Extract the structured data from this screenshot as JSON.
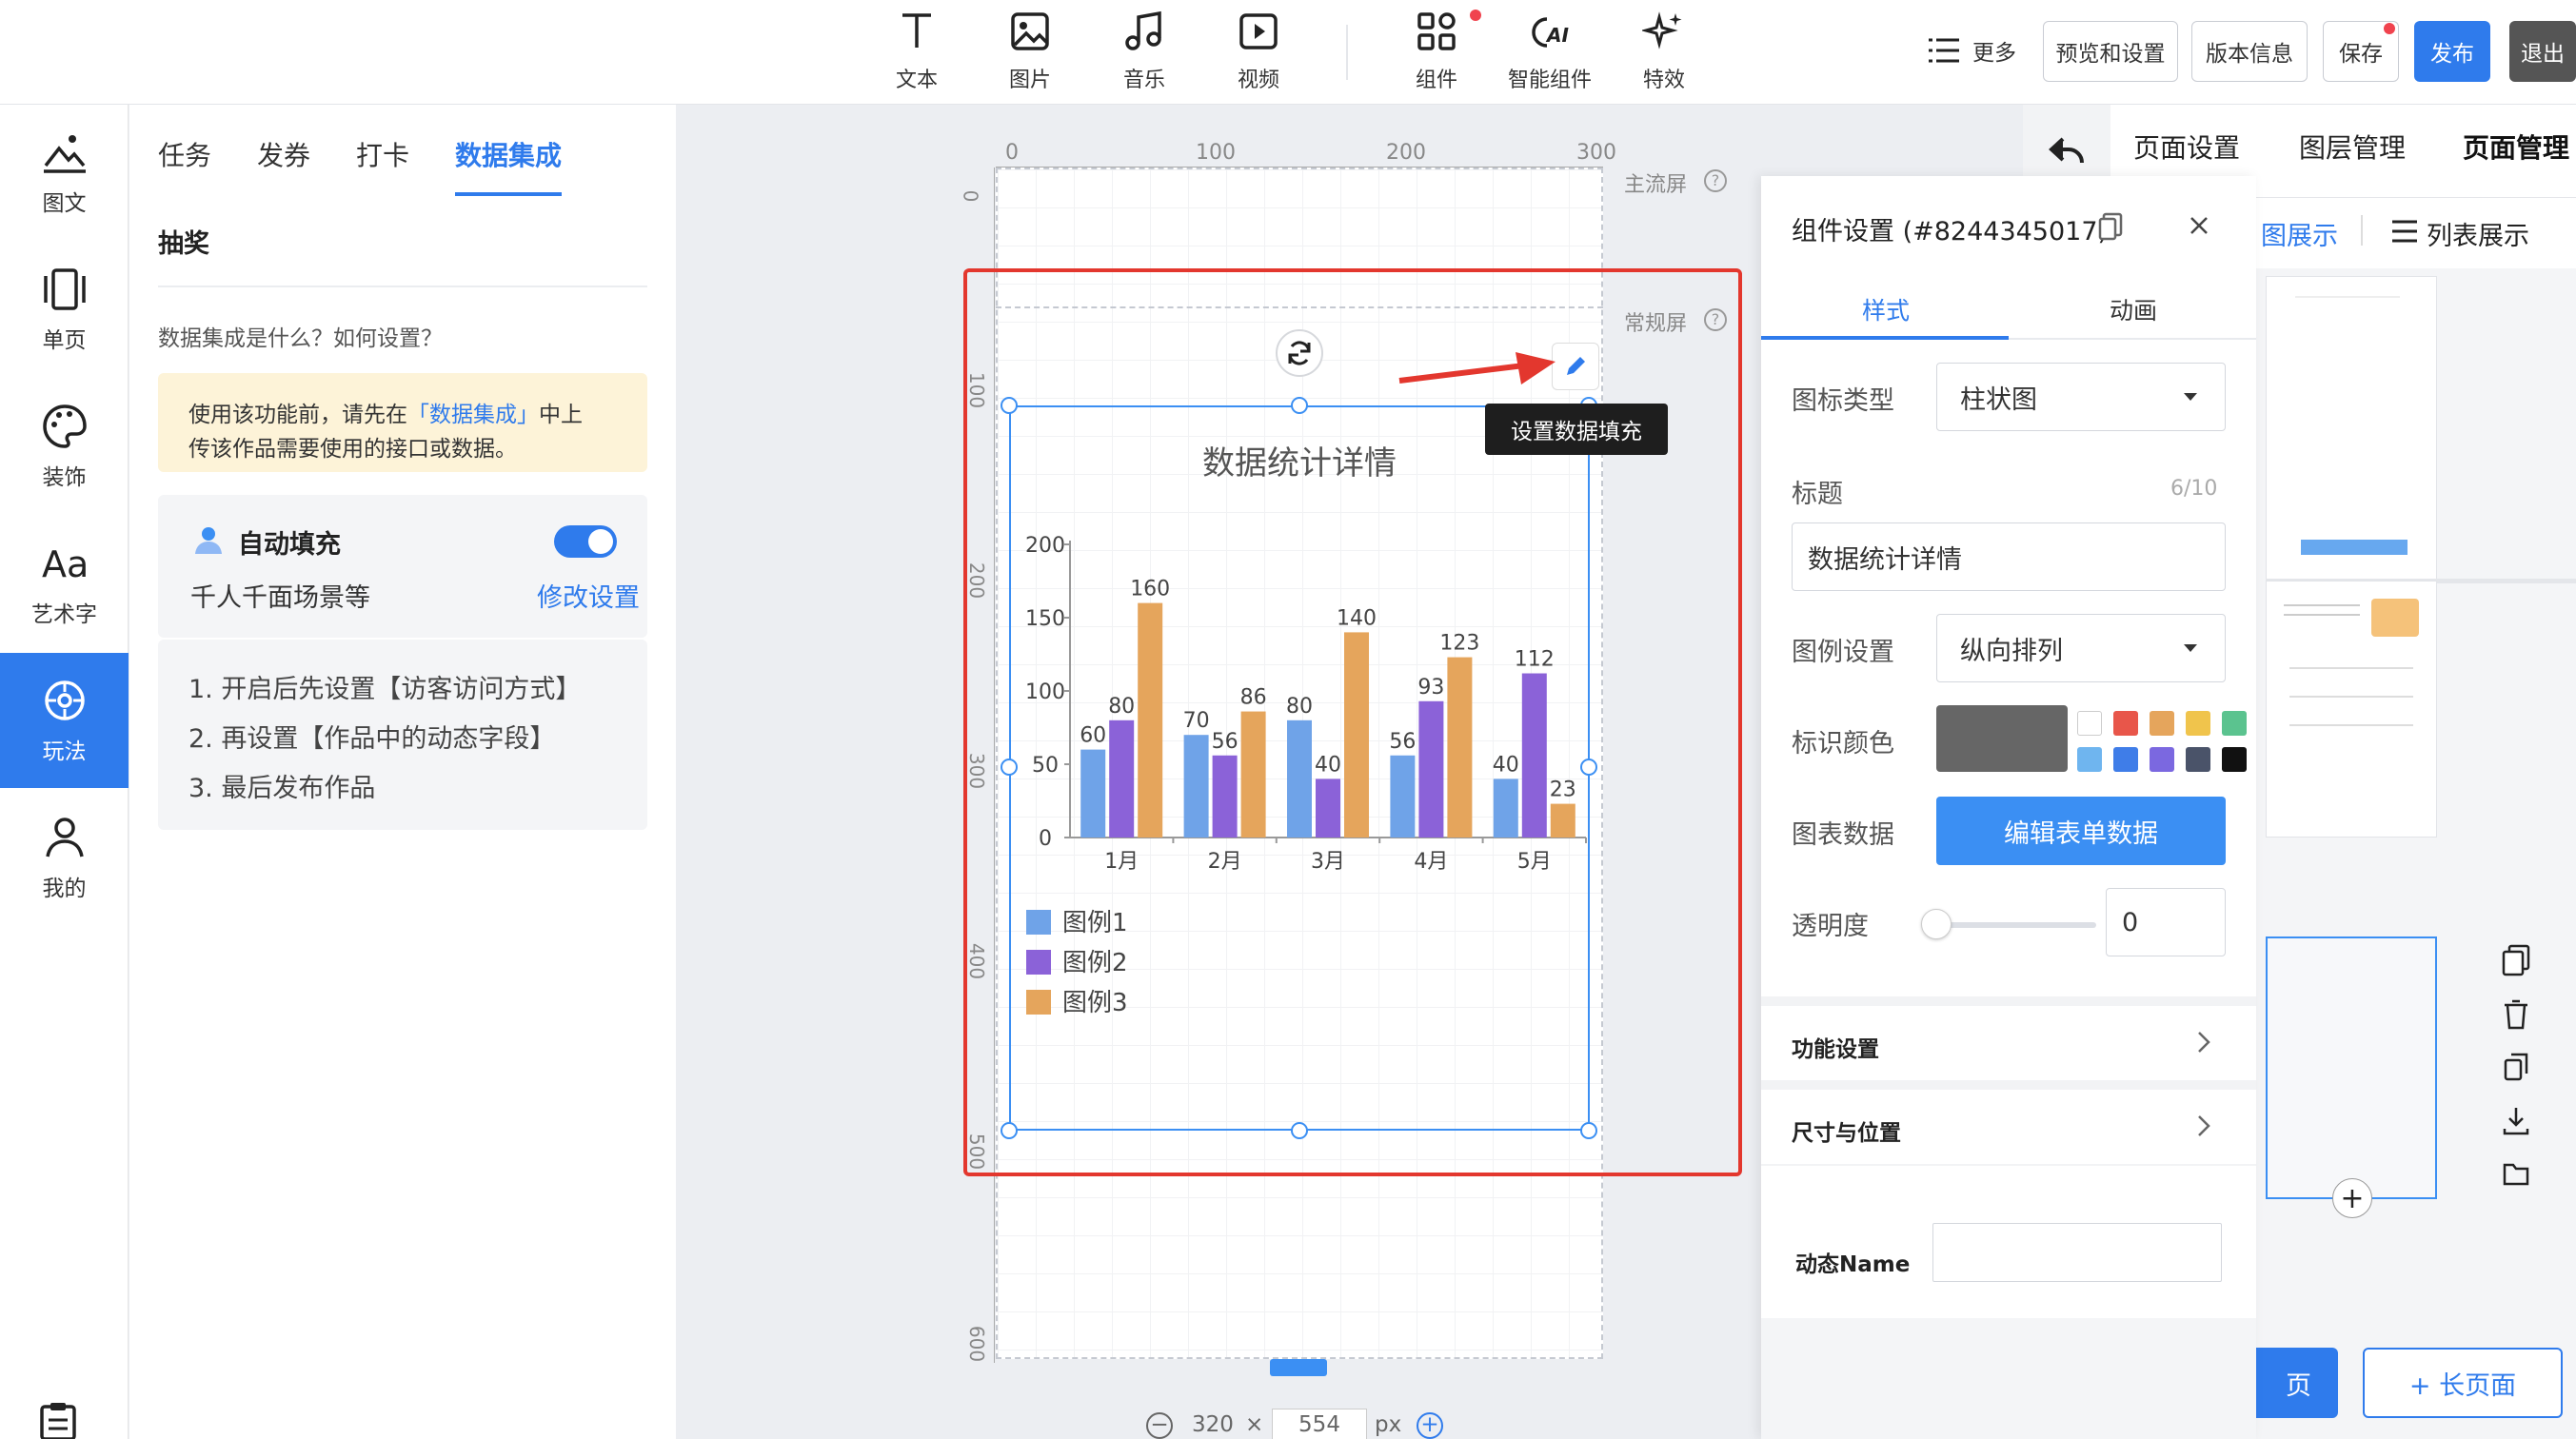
{
  "toolbar": {
    "tools": [
      {
        "label": "文本",
        "icon": "text-icon"
      },
      {
        "label": "图片",
        "icon": "image-icon"
      },
      {
        "label": "音乐",
        "icon": "music-icon"
      },
      {
        "label": "视频",
        "icon": "video-icon"
      },
      {
        "label": "组件",
        "icon": "components-icon"
      },
      {
        "label": "智能组件",
        "icon": "ai-components-icon"
      },
      {
        "label": "特效",
        "icon": "effects-icon"
      }
    ],
    "more": "更多",
    "preview": "预览和设置",
    "version": "版本信息",
    "save": "保存",
    "publish": "发布",
    "exit": "退出"
  },
  "leftnav": [
    {
      "label": "图文",
      "icon": "image-text-icon"
    },
    {
      "label": "单页",
      "icon": "single-page-icon"
    },
    {
      "label": "装饰",
      "icon": "palette-icon"
    },
    {
      "label": "艺术字",
      "icon": "art-text-icon"
    },
    {
      "label": "玩法",
      "icon": "gameplay-icon",
      "active": true
    },
    {
      "label": "我的",
      "icon": "user-icon"
    }
  ],
  "panel": {
    "tabs": [
      "任务",
      "发券",
      "打卡",
      "数据集成"
    ],
    "active_tab": "数据集成",
    "sub_item": "抽奖",
    "help": "数据集成是什么？如何设置？",
    "notice_a": "使用该功能前，请先在",
    "notice_link": "「数据集成」",
    "notice_b": "中上",
    "notice_c": "传该作品需要使用的接口或数据。",
    "auto_fill_title": "自动填充",
    "auto_fill_desc": "千人千面场景等",
    "modify": "修改设置",
    "steps": [
      "1. 开启后先设置【访客访问方式】",
      "2. 再设置【作品中的动态字段】",
      "3. 最后发布作品"
    ]
  },
  "canvas": {
    "ruler_top": [
      "0",
      "100",
      "200",
      "300"
    ],
    "ruler_left": [
      "0",
      "100",
      "200",
      "300",
      "400",
      "500",
      "600"
    ],
    "main_screen": "主流屏",
    "normal_screen": "常规屏",
    "tooltip": "设置数据填充",
    "width": "320",
    "height": "554",
    "unit": "px",
    "times": "×"
  },
  "chart_data": {
    "type": "bar",
    "title": "数据统计详情",
    "categories": [
      "1月",
      "2月",
      "3月",
      "4月",
      "5月"
    ],
    "series": [
      {
        "name": "图例1",
        "values": [
          60,
          70,
          80,
          56,
          40
        ],
        "color": "#6fa3e8"
      },
      {
        "name": "图例2",
        "values": [
          80,
          56,
          40,
          93,
          112
        ],
        "color": "#8b62d8"
      },
      {
        "name": "图例3",
        "values": [
          160,
          86,
          140,
          123,
          23
        ],
        "color": "#e5a55c"
      }
    ],
    "yticks": [
      "200",
      "150",
      "100",
      "50",
      "0"
    ],
    "ylim": [
      0,
      200
    ],
    "legend": "bottom-left, vertical"
  },
  "right": {
    "tabs": [
      "页面设置",
      "图层管理",
      "页面管理"
    ],
    "view_thumb": "图展示",
    "view_list": "列表展示",
    "add_long_page": "+ 长页面",
    "add_page_partial": "页"
  },
  "component": {
    "title": "组件设置 (#8244345017)",
    "tabs": [
      "样式",
      "动画"
    ],
    "chart_type_label": "图标类型",
    "chart_type_value": "柱状图",
    "title_label": "标题",
    "title_count": "6/10",
    "title_value": "数据统计详情",
    "legend_label": "图例设置",
    "legend_value": "纵向排列",
    "color_label": "标识颜色",
    "colors": [
      "#ffffff",
      "#e8564a",
      "#e5a55c",
      "#f0c44c",
      "#5bc38f",
      "#6fb5ef",
      "#3f7de8",
      "#7b68e0",
      "#4a5369",
      "#111111"
    ],
    "main_color": "#666666",
    "data_label": "图表数据",
    "edit_btn": "编辑表单数据",
    "opacity_label": "透明度",
    "opacity_value": "0",
    "func": "功能设置",
    "size": "尺寸与位置",
    "dyn_name": "动态Name"
  }
}
